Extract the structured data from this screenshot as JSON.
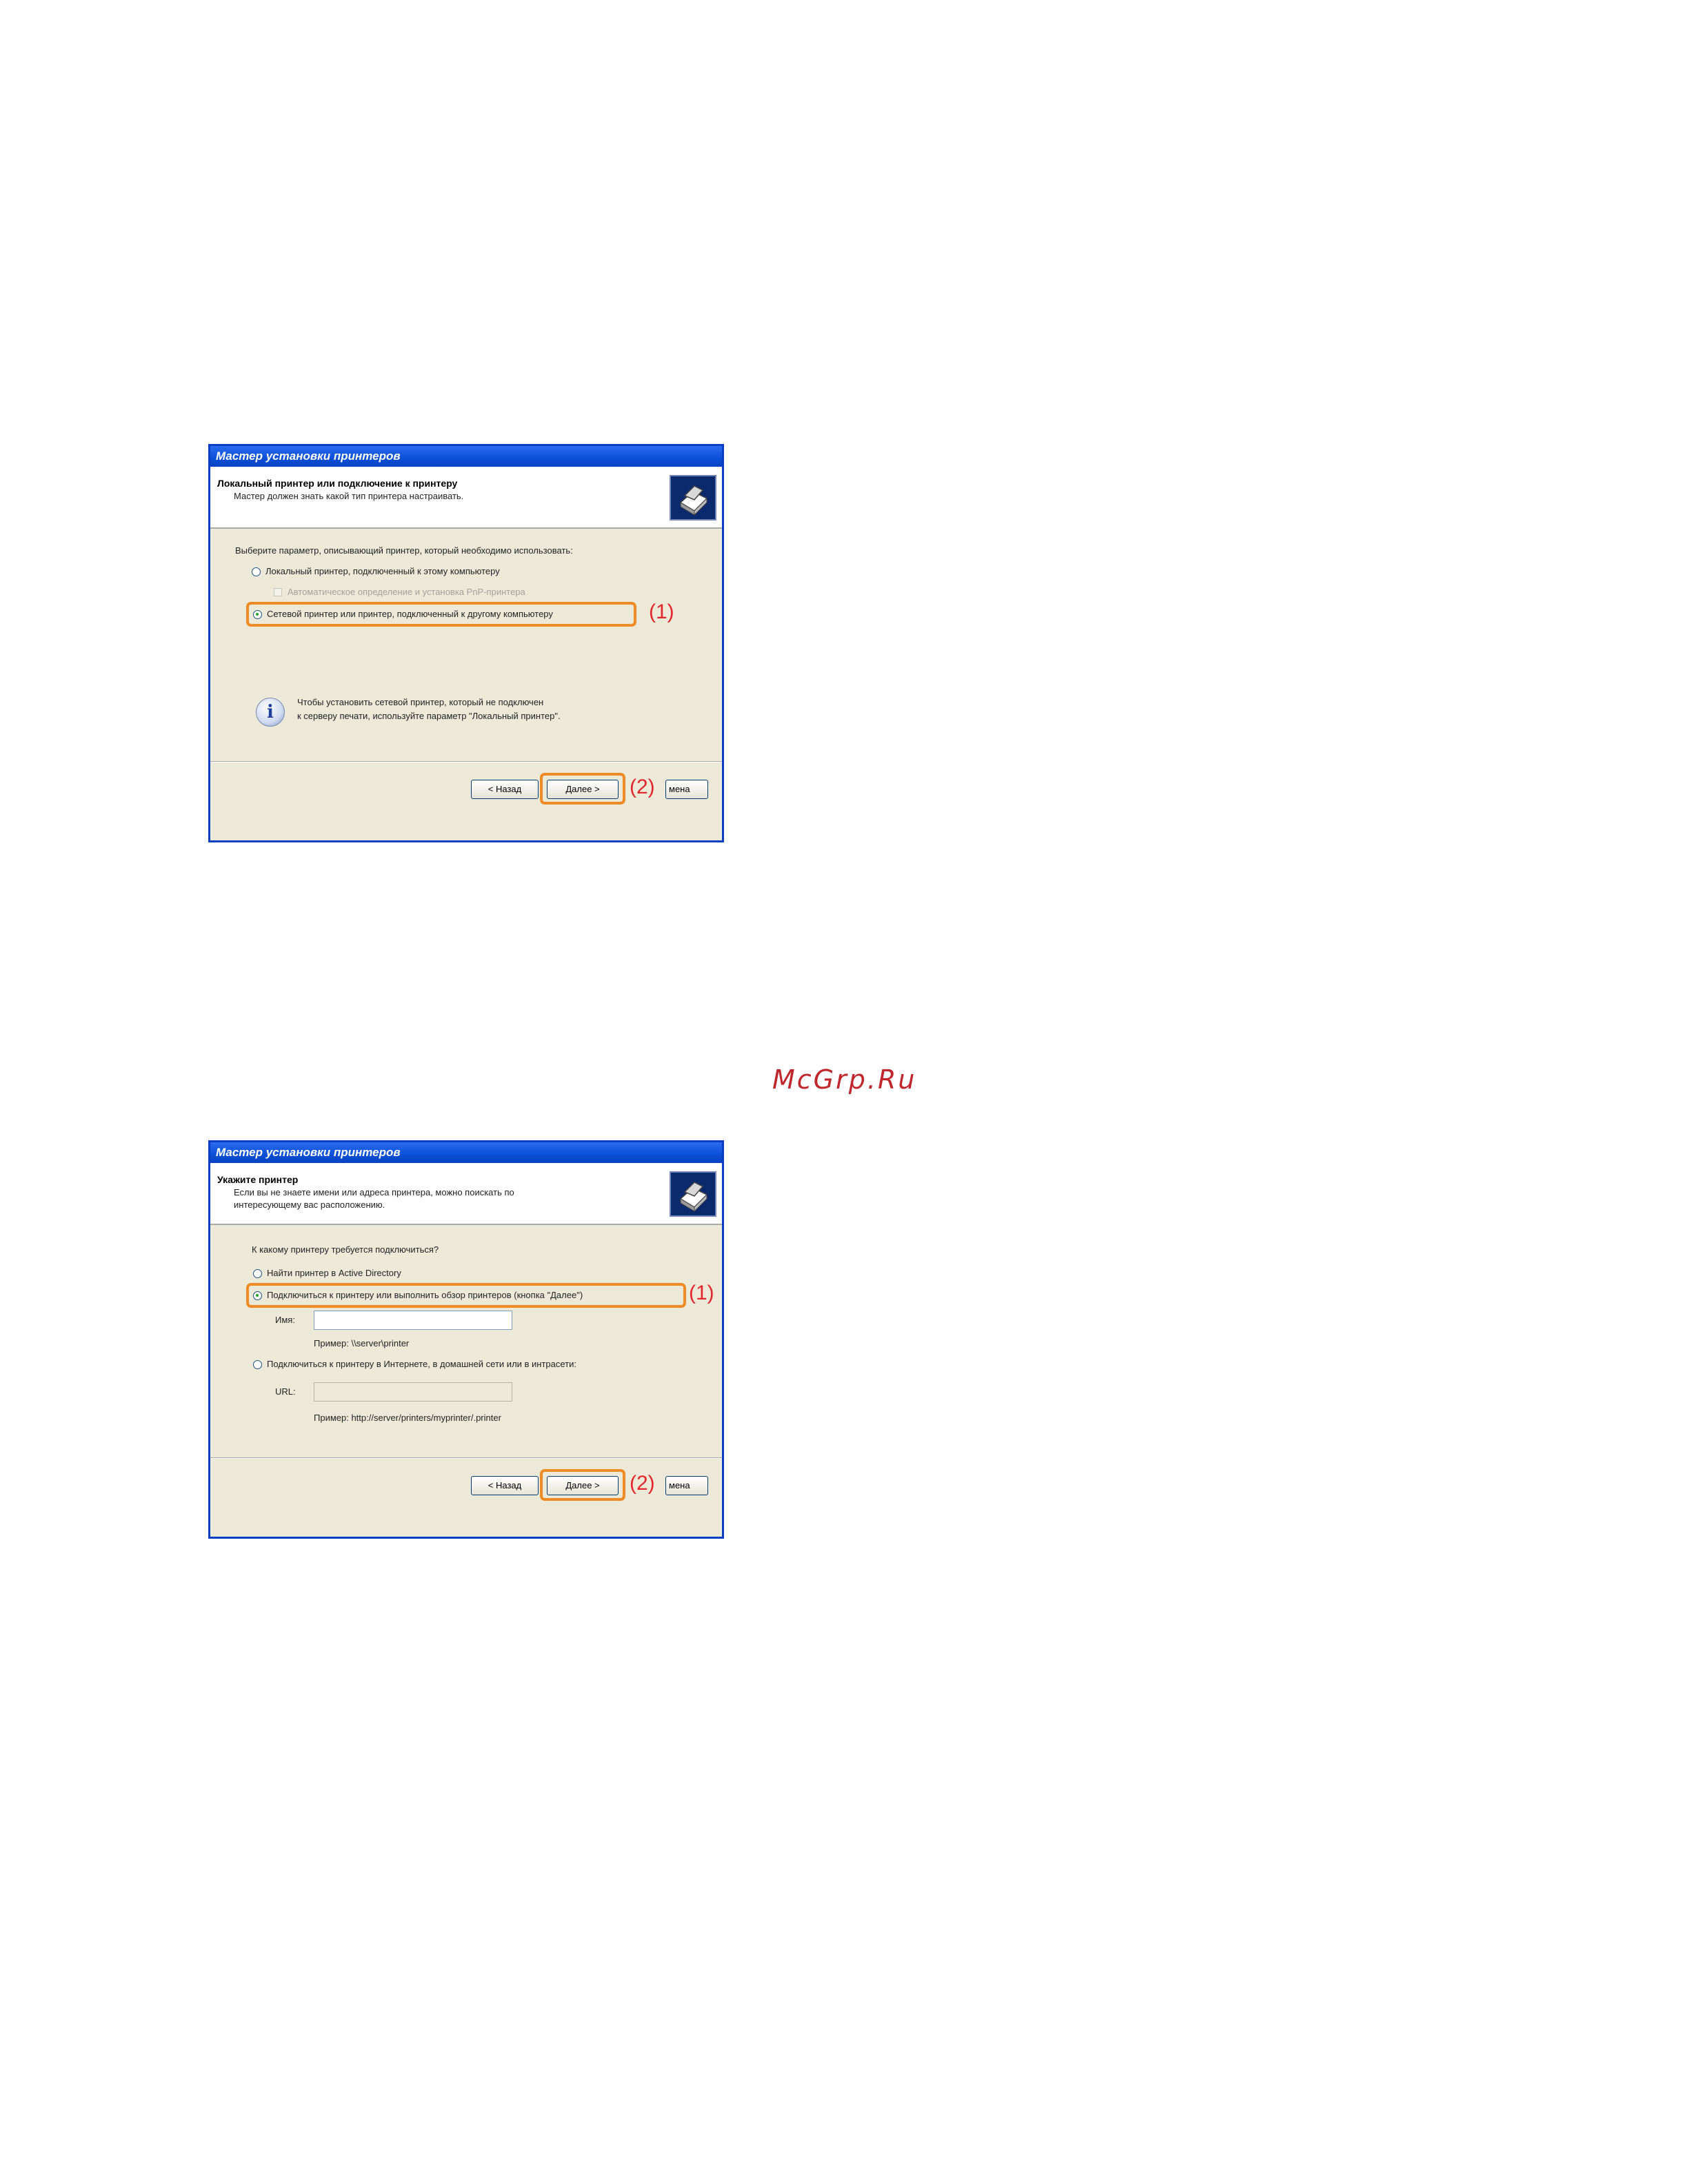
{
  "watermark": "McGrp.Ru",
  "dialog1": {
    "title": "Мастер установки принтеров",
    "header_title": "Локальный принтер или подключение к принтеру",
    "header_subtitle": "Мастер должен знать какой тип принтера настраивать.",
    "prompt": "Выберите параметр, описывающий принтер, который необходимо использовать:",
    "option_local": "Локальный принтер, подключенный к этому компьютеру",
    "option_pnp": "Автоматическое определение и установка PnP-принтера",
    "option_network": "Сетевой принтер или принтер, подключенный к другому компьютеру",
    "info_line1": "Чтобы установить сетевой принтер, который не подключен",
    "info_line2": "к серверу печати, используйте параметр \"Локальный принтер\".",
    "back_label": "< Назад",
    "next_label": "Далее >",
    "cancel_label": "мена",
    "callout1": "(1)",
    "callout2": "(2)"
  },
  "dialog2": {
    "title": "Мастер установки принтеров",
    "header_title": "Укажите принтер",
    "header_subtitle_1": "Если вы не знаете имени или адреса принтера, можно поискать по",
    "header_subtitle_2": "интересующему вас расположению.",
    "prompt": "К какому принтеру требуется подключиться?",
    "option_ad": "Найти принтер в Active Directory",
    "option_connect": "Подключиться к принтеру или выполнить обзор принтеров (кнопка \"Далее\")",
    "name_label": "Имя:",
    "name_value": "",
    "name_example": "Пример: \\\\server\\printer",
    "option_internet": "Подключиться к принтеру в Интернете, в домашней сети или в интрасети:",
    "url_label": "URL:",
    "url_value": "",
    "url_example": "Пример: http://server/printers/myprinter/.printer",
    "back_label": "< Назад",
    "next_label": "Далее >",
    "cancel_label": "мена",
    "callout1": "(1)",
    "callout2": "(2)"
  }
}
